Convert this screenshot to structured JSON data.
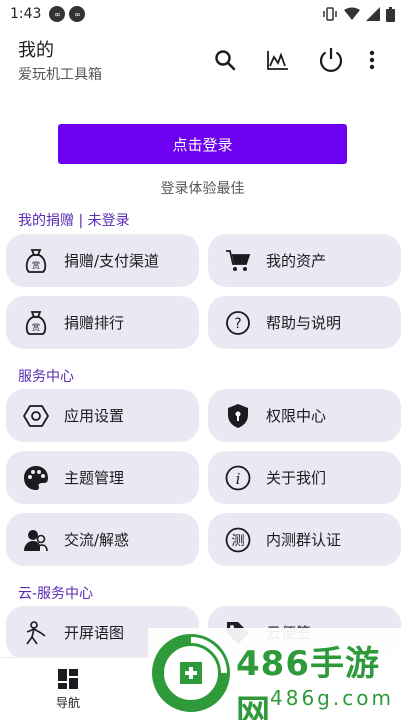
{
  "status_bar": {
    "time": "1:43"
  },
  "app_bar": {
    "title": "我的",
    "subtitle": "爱玩机工具箱"
  },
  "login": {
    "button_label": "点击登录",
    "hint": "登录体验最佳"
  },
  "sections": {
    "donation": {
      "title": "我的捐赠 | 未登录",
      "items": [
        {
          "label": "捐赠/支付渠道",
          "icon": "money-bag-icon"
        },
        {
          "label": "我的资产",
          "icon": "cart-icon"
        },
        {
          "label": "捐赠排行",
          "icon": "money-bag-icon"
        },
        {
          "label": "帮助与说明",
          "icon": "help-icon"
        }
      ]
    },
    "service": {
      "title": "服务中心",
      "items": [
        {
          "label": "应用设置",
          "icon": "settings-icon"
        },
        {
          "label": "权限中心",
          "icon": "shield-icon"
        },
        {
          "label": "主题管理",
          "icon": "palette-icon"
        },
        {
          "label": "关于我们",
          "icon": "info-icon"
        },
        {
          "label": "交流/解惑",
          "icon": "people-icon"
        },
        {
          "label": "内测群认证",
          "icon": "test-badge-icon"
        }
      ]
    },
    "cloud": {
      "title": "云-服务中心",
      "items": [
        {
          "label": "开屏语图",
          "icon": "figure-icon"
        },
        {
          "label": "云便签",
          "icon": "tag-icon"
        }
      ]
    }
  },
  "bottom_nav": {
    "items": [
      {
        "label": "导航",
        "icon": "dashboard-icon"
      }
    ]
  },
  "watermark": {
    "text": "486手游网",
    "url": "486g.com"
  },
  "colors": {
    "accent": "#6d00f0",
    "section": "#5a2bb3",
    "card": "#ece8f3",
    "watermark": "#2e9a3a"
  }
}
